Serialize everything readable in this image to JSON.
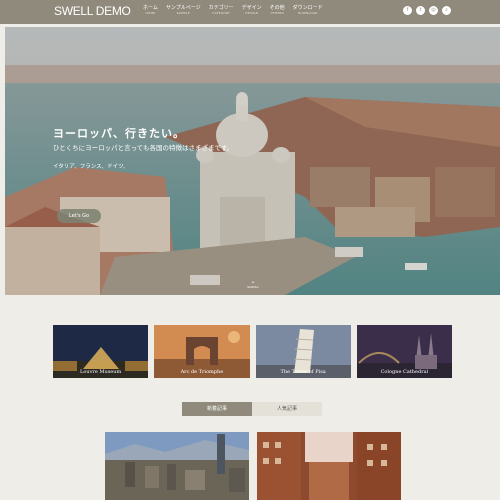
{
  "header": {
    "logo": "SWELL DEMO",
    "nav": [
      {
        "label": "ホーム",
        "sub": "HOME"
      },
      {
        "label": "サンプルページ",
        "sub": "SAMPLE"
      },
      {
        "label": "カテゴリー",
        "sub": "CATEGORY"
      },
      {
        "label": "デザイン",
        "sub": "DESIGN"
      },
      {
        "label": "その他",
        "sub": "OTHERS"
      },
      {
        "label": "ダウンロード",
        "sub": "DOWNLOAD"
      }
    ],
    "social_icons": [
      "facebook-icon",
      "twitter-icon",
      "instagram-icon",
      "search-icon"
    ]
  },
  "hero": {
    "title": "ヨーロッパ、行きたい。",
    "subtitle": "ひとくちにヨーロッパと言っても各国の特徴はさまざまです。",
    "caption": "イタリア、フランス、ドイツ、",
    "button": "Let's Go",
    "scroll_label": "SCROLL",
    "scroll_icon": "chevron-down-icon"
  },
  "pickup": [
    {
      "label": "Louvre Museum"
    },
    {
      "label": "Arc de Triomphe"
    },
    {
      "label": "The Tower of Pisa"
    },
    {
      "label": "Cologne Cathedral"
    }
  ],
  "tabs": [
    {
      "label": "新着記事",
      "active": true
    },
    {
      "label": "人気記事",
      "active": false
    }
  ],
  "colors": {
    "header_bg": "#8f8a7c",
    "page_bg": "#efede8",
    "button_bg": "#7d8372"
  }
}
